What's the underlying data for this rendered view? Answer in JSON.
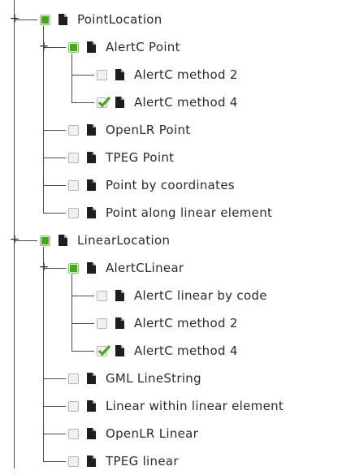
{
  "tree": [
    {
      "label": "PointLocation",
      "state": "partial",
      "expander": true,
      "children": [
        {
          "label": "AlertC Point",
          "state": "partial",
          "expander": true,
          "children": [
            {
              "label": "AlertC method 2",
              "state": "unchecked"
            },
            {
              "label": "AlertC method 4",
              "state": "checked"
            }
          ]
        },
        {
          "label": "OpenLR Point",
          "state": "unchecked"
        },
        {
          "label": "TPEG Point",
          "state": "unchecked"
        },
        {
          "label": "Point by coordinates",
          "state": "unchecked"
        },
        {
          "label": "Point along linear element",
          "state": "unchecked"
        }
      ]
    },
    {
      "label": "LinearLocation",
      "state": "partial",
      "expander": true,
      "children": [
        {
          "label": "AlertCLinear",
          "state": "partial",
          "expander": true,
          "children": [
            {
              "label": "AlertC linear by code",
              "state": "unchecked"
            },
            {
              "label": "AlertC method 2",
              "state": "unchecked"
            },
            {
              "label": "AlertC method 4",
              "state": "checked"
            }
          ]
        },
        {
          "label": "GML LineString",
          "state": "unchecked"
        },
        {
          "label": "Linear within linear element",
          "state": "unchecked"
        },
        {
          "label": "OpenLR Linear",
          "state": "unchecked"
        },
        {
          "label": "TPEG linear",
          "state": "unchecked"
        }
      ]
    }
  ],
  "colors": {
    "check_green": "#46a81e",
    "line": "#4a4a4a",
    "text": "#2b2b2b"
  },
  "icons": {
    "node": "document-icon",
    "expander": "plus-icon",
    "check": "check-icon"
  }
}
